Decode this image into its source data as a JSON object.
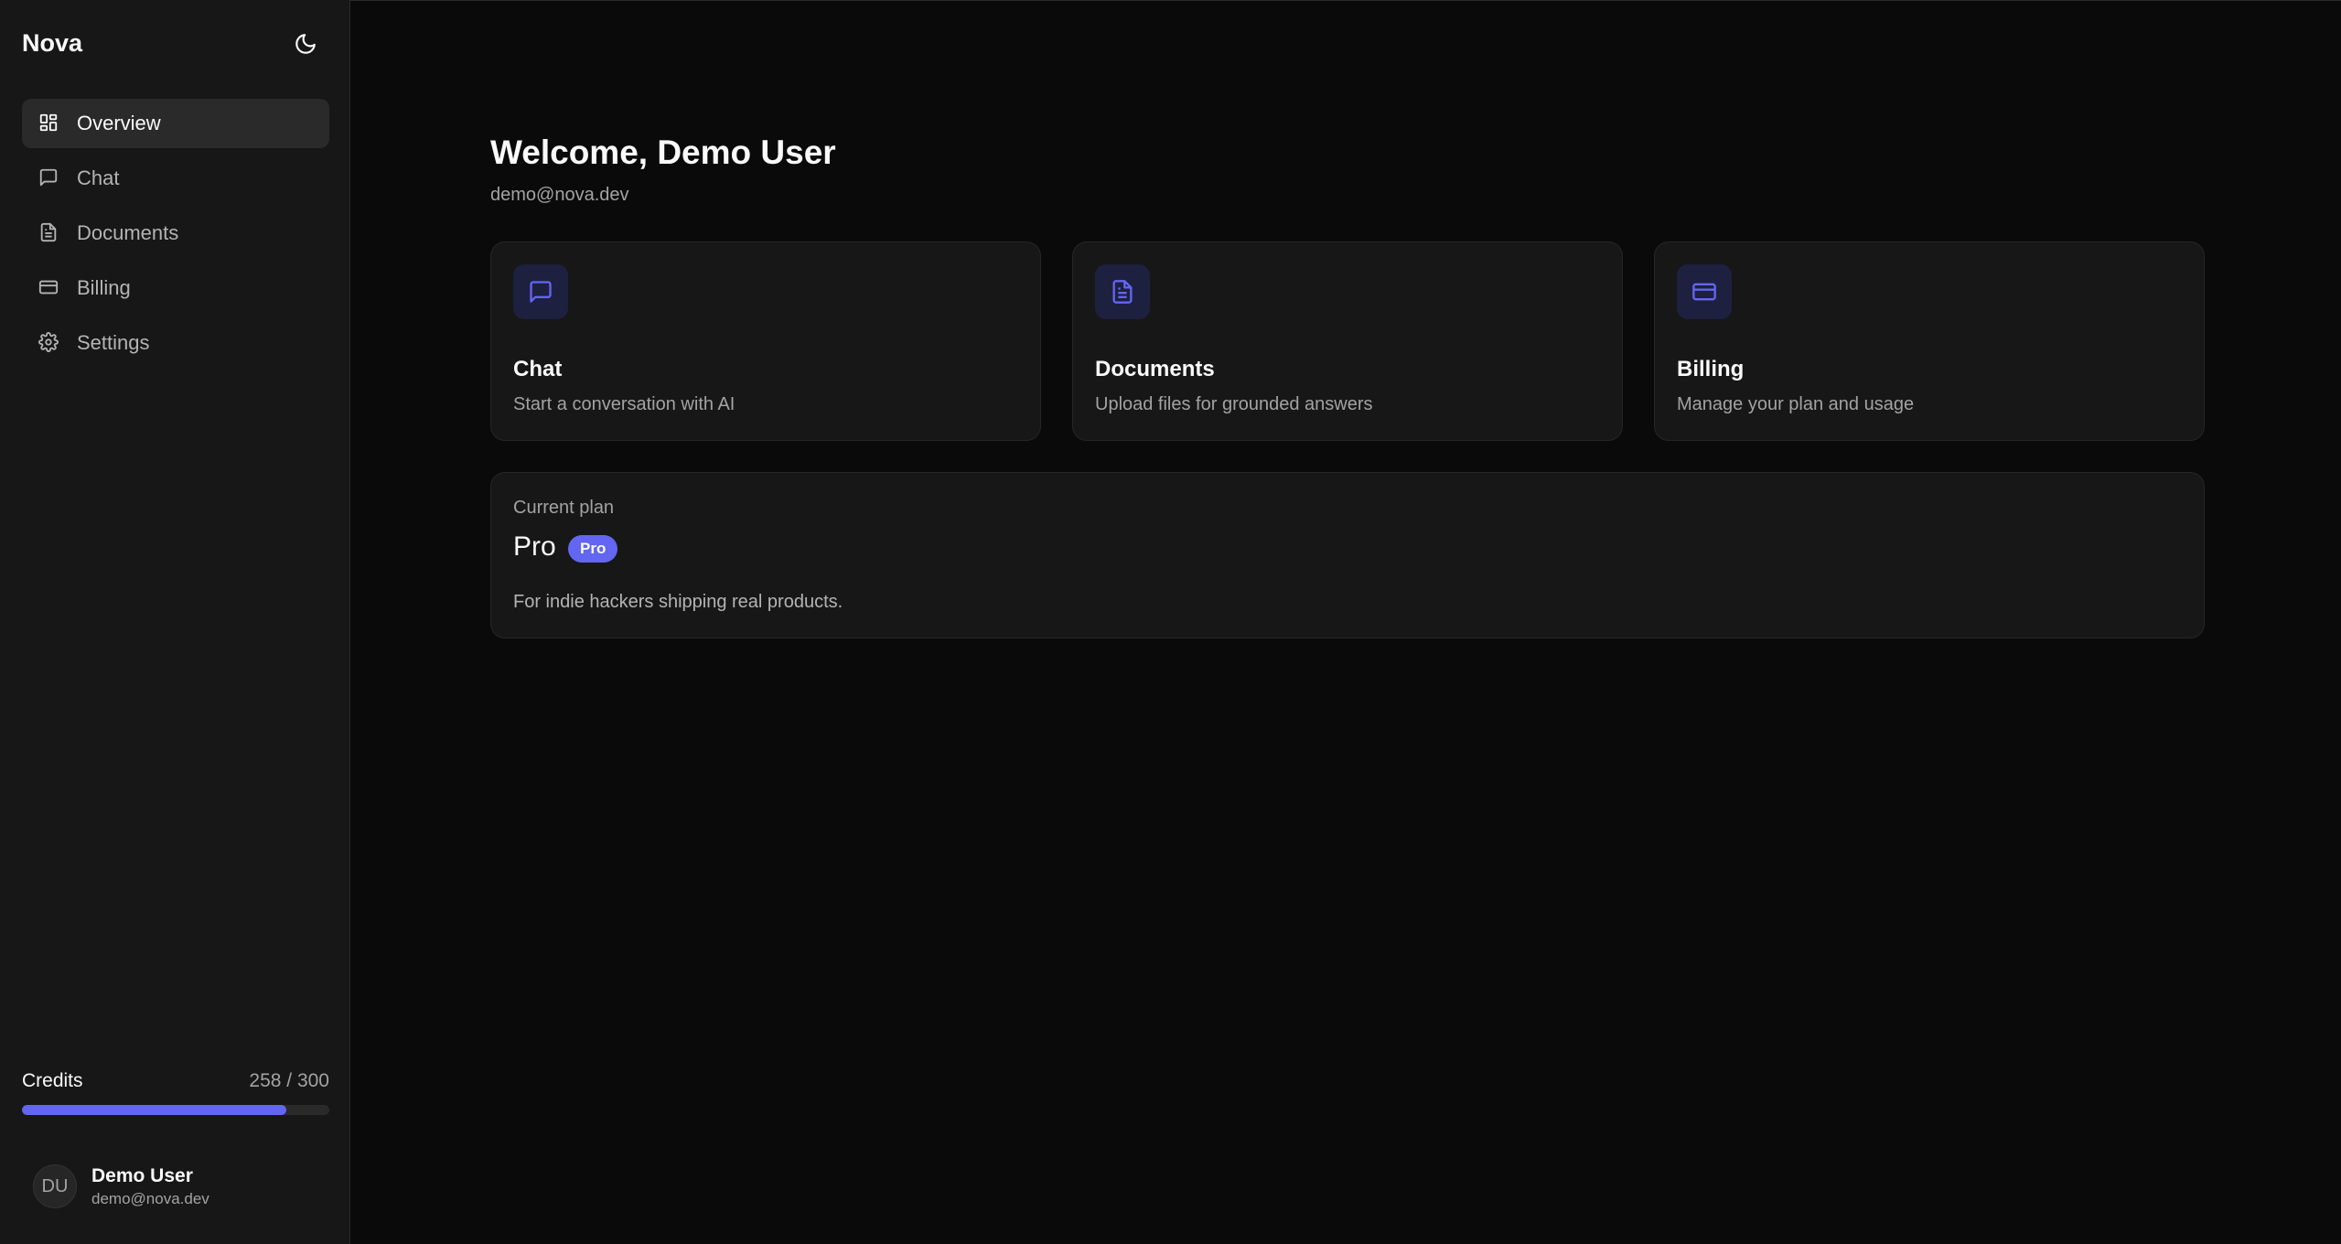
{
  "sidebar": {
    "brand": "Nova",
    "theme_toggle_icon": "moon-icon",
    "nav": [
      {
        "label": "Overview",
        "icon": "dashboard-icon",
        "active": true
      },
      {
        "label": "Chat",
        "icon": "chat-icon",
        "active": false
      },
      {
        "label": "Documents",
        "icon": "document-icon",
        "active": false
      },
      {
        "label": "Billing",
        "icon": "credit-card-icon",
        "active": false
      },
      {
        "label": "Settings",
        "icon": "gear-icon",
        "active": false
      }
    ],
    "credits": {
      "label": "Credits",
      "value": "258 / 300",
      "fraction": 0.86
    },
    "user": {
      "initials": "DU",
      "name": "Demo User",
      "email": "demo@nova.dev"
    }
  },
  "main": {
    "welcome": "Welcome, Demo User",
    "email": "demo@nova.dev",
    "cards": [
      {
        "title": "Chat",
        "description": "Start a conversation with AI",
        "icon": "chat-icon"
      },
      {
        "title": "Documents",
        "description": "Upload files for grounded answers",
        "icon": "document-icon"
      },
      {
        "title": "Billing",
        "description": "Manage your plan and usage",
        "icon": "credit-card-icon"
      }
    ],
    "plan": {
      "label": "Current plan",
      "name": "Pro",
      "badge": "Pro",
      "description": "For indie hackers shipping real products."
    }
  },
  "colors": {
    "accent": "#6366f1",
    "background": "#0a0a0a",
    "sidebar": "#171717",
    "card": "#171717"
  }
}
